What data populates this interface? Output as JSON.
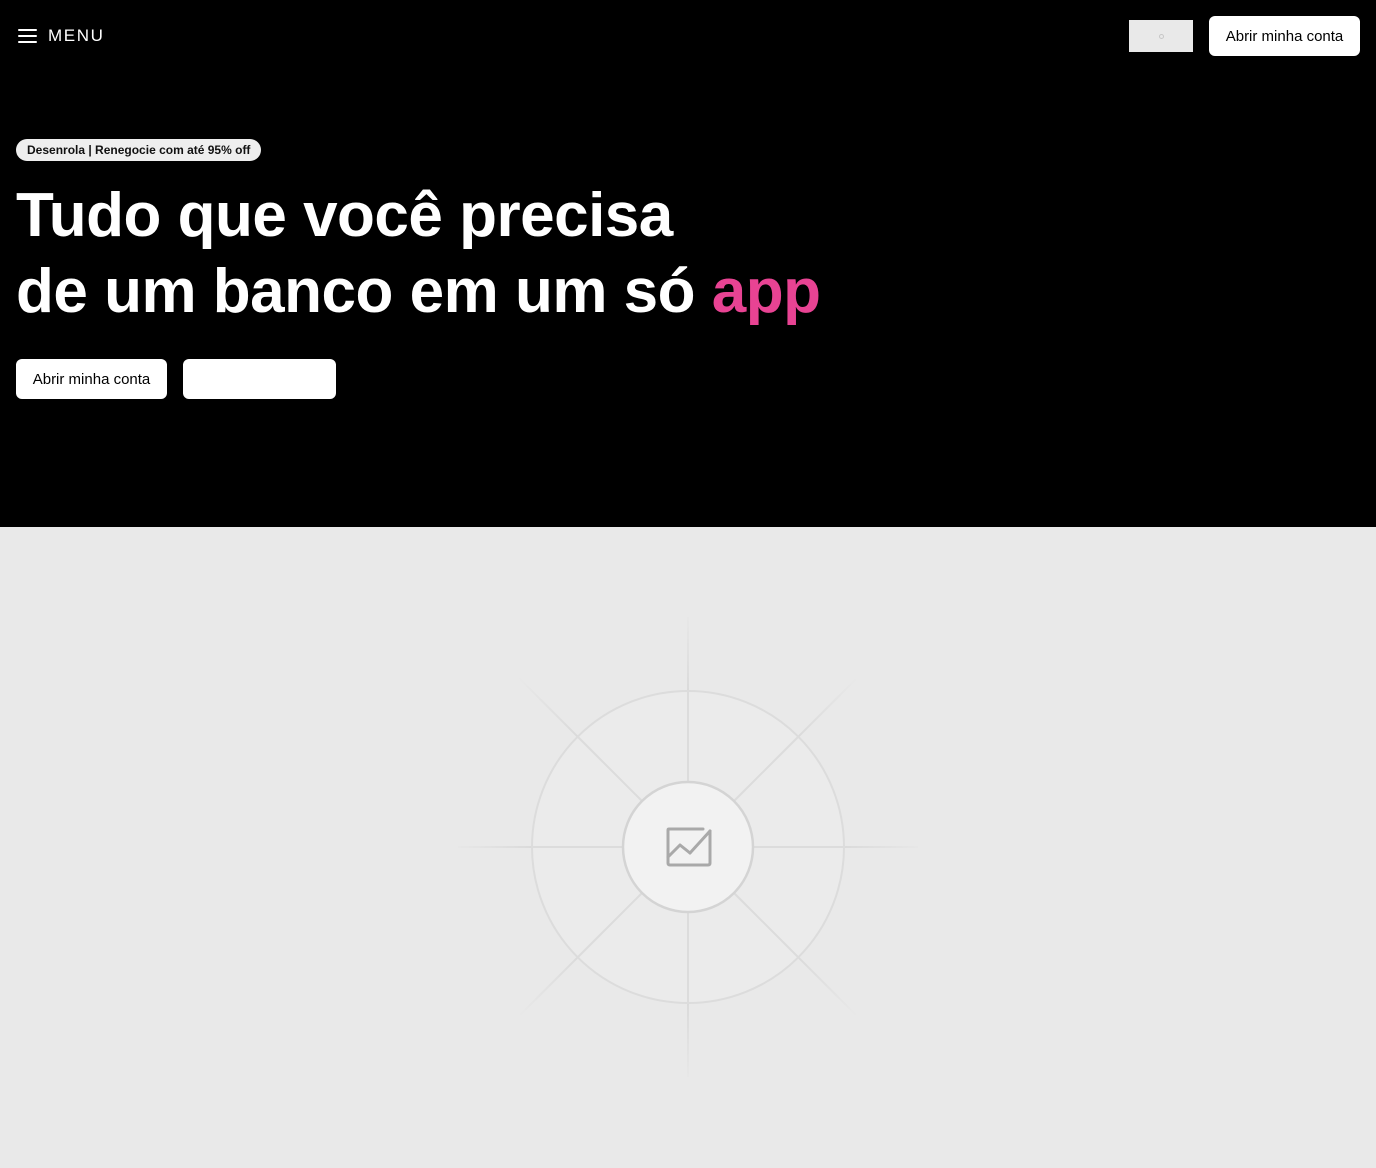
{
  "header": {
    "menu_label": "MENU",
    "cta_label": "Abrir minha conta"
  },
  "hero": {
    "badge_text": "Desenrola | Renegocie com até 95% off",
    "headline_line1": "Tudo que você precisa",
    "headline_line2_prefix": "de um banco em um só ",
    "headline_accent": "app",
    "primary_cta_label": "Abrir minha conta",
    "secondary_cta_label": ""
  },
  "media": {
    "icon": "image-placeholder-icon"
  },
  "colors": {
    "hero_background": "#000000",
    "accent": "#e84393",
    "media_background": "#e9e9e9"
  }
}
